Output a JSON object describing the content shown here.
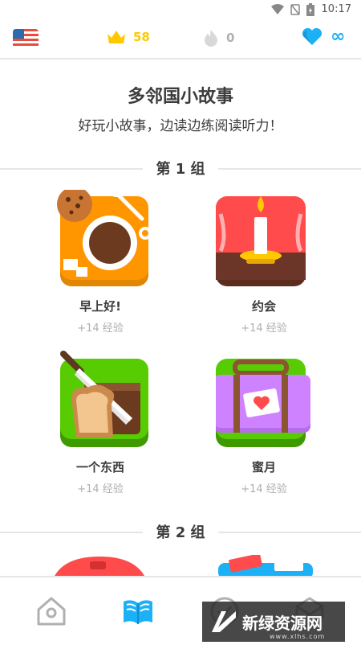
{
  "status_bar": {
    "time": "10:17"
  },
  "top_bar": {
    "crowns": "58",
    "streak": "0",
    "hearts": "∞"
  },
  "header": {
    "title": "多邻国小故事",
    "subtitle": "好玩小故事，边读边练阅读听力！"
  },
  "groups": [
    {
      "label": "第 1 组",
      "stories": [
        {
          "title": "早上好!",
          "xp": "+14 经验",
          "icon": "coffee-cookie-icon"
        },
        {
          "title": "约会",
          "xp": "+14 经验",
          "icon": "candle-dinner-icon"
        },
        {
          "title": "一个东西",
          "xp": "+14 经验",
          "icon": "bread-knife-icon"
        },
        {
          "title": "蜜月",
          "xp": "+14 经验",
          "icon": "suitcase-heart-icon"
        }
      ]
    },
    {
      "label": "第 2 组"
    }
  ],
  "watermark": {
    "text": "新绿资源网",
    "url": "www.xlhs.com"
  },
  "colors": {
    "crown": "#ffc800",
    "heart": "#1cb0f6",
    "tile_orange": "#ff9600",
    "tile_red": "#ff4b4b",
    "tile_green": "#58cc02",
    "tile_purple": "#ce82ff"
  }
}
